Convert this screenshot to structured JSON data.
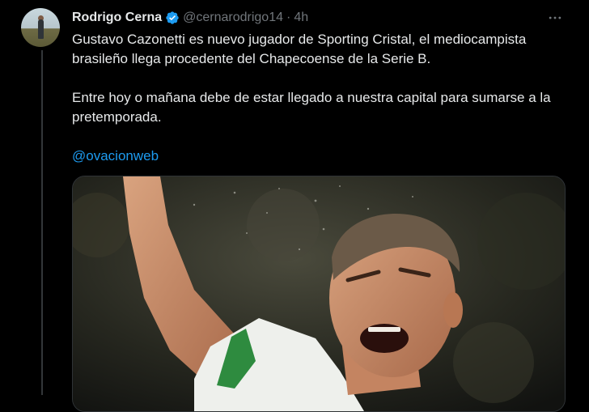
{
  "tweet": {
    "display_name": "Rodrigo Cerna",
    "handle": "@cernarodrigo14",
    "separator": "·",
    "time": "4h",
    "paragraph_1": "Gustavo Cazonetti es nuevo jugador de Sporting Cristal, el mediocampista brasileño llega procedente del Chapecoense de la Serie B.",
    "paragraph_2": "Entre hoy o mañana debe de estar llegado a nuestra capital para sumarse a la pretemporada.",
    "mention": "@ovacionweb"
  },
  "icons": {
    "verified": "verified-badge-icon",
    "more": "more-horizontal-icon"
  },
  "colors": {
    "background": "#000000",
    "text": "#e7e9ea",
    "secondary_text": "#71767b",
    "link": "#1d9bf0",
    "verified": "#1d9bf0",
    "border": "#2f3336"
  }
}
